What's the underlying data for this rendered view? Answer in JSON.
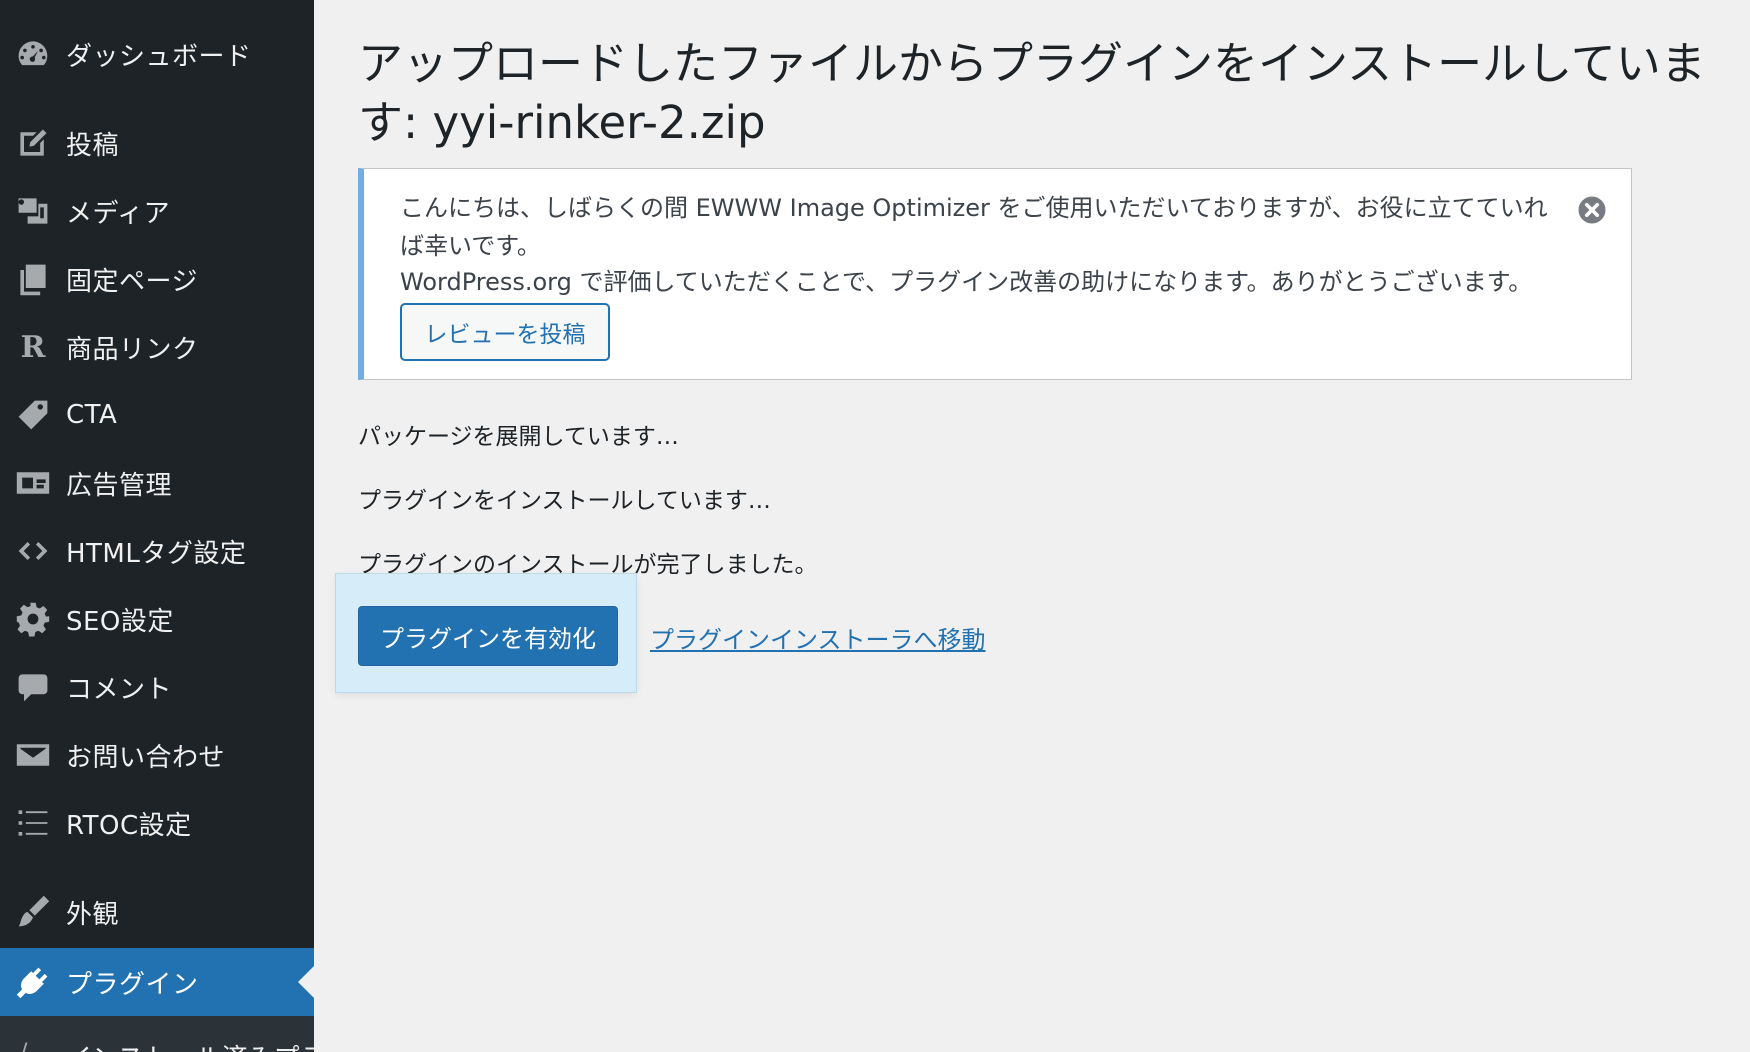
{
  "sidebar": {
    "items": [
      {
        "label": "ダッシュボード",
        "icon": "dashboard-icon"
      },
      {
        "label": "投稿",
        "icon": "posts-icon"
      },
      {
        "label": "メディア",
        "icon": "media-icon"
      },
      {
        "label": "固定ページ",
        "icon": "pages-icon"
      },
      {
        "label": "商品リンク",
        "icon": "rinker-r-icon"
      },
      {
        "label": "CTA",
        "icon": "tag-icon"
      },
      {
        "label": "広告管理",
        "icon": "ad-icon"
      },
      {
        "label": "HTMLタグ設定",
        "icon": "code-icon"
      },
      {
        "label": "SEO設定",
        "icon": "gear-icon"
      },
      {
        "label": "コメント",
        "icon": "comment-icon"
      },
      {
        "label": "お問い合わせ",
        "icon": "mail-icon"
      },
      {
        "label": "RTOC設定",
        "icon": "list-icon"
      },
      {
        "label": "外観",
        "icon": "brush-icon"
      },
      {
        "label": "プラグイン",
        "icon": "plugin-icon",
        "current": true
      }
    ],
    "submenu_partial": "インストール済みプラグ"
  },
  "page": {
    "title": "アップロードしたファイルからプラグインをインストールしています: yyi-rinker-2.zip"
  },
  "notice": {
    "line1": "こんにちは、しばらくの間 EWWW Image Optimizer をご使用いただいておりますが、お役に立てていれば幸いです。",
    "line2": "WordPress.org で評価していただくことで、プラグイン改善の助けになります。ありがとうございます。",
    "review_button": "レビューを投稿"
  },
  "messages": {
    "unpacking": "パッケージを展開しています…",
    "installing": "プラグインをインストールしています…",
    "done": "プラグインのインストールが完了しました。"
  },
  "actions": {
    "activate": "プラグインを有効化",
    "installer_link": "プラグインインストーラへ移動"
  },
  "colors": {
    "sidebar_bg": "#1d2327",
    "accent": "#2271b1",
    "notice_border": "#72aee6"
  }
}
